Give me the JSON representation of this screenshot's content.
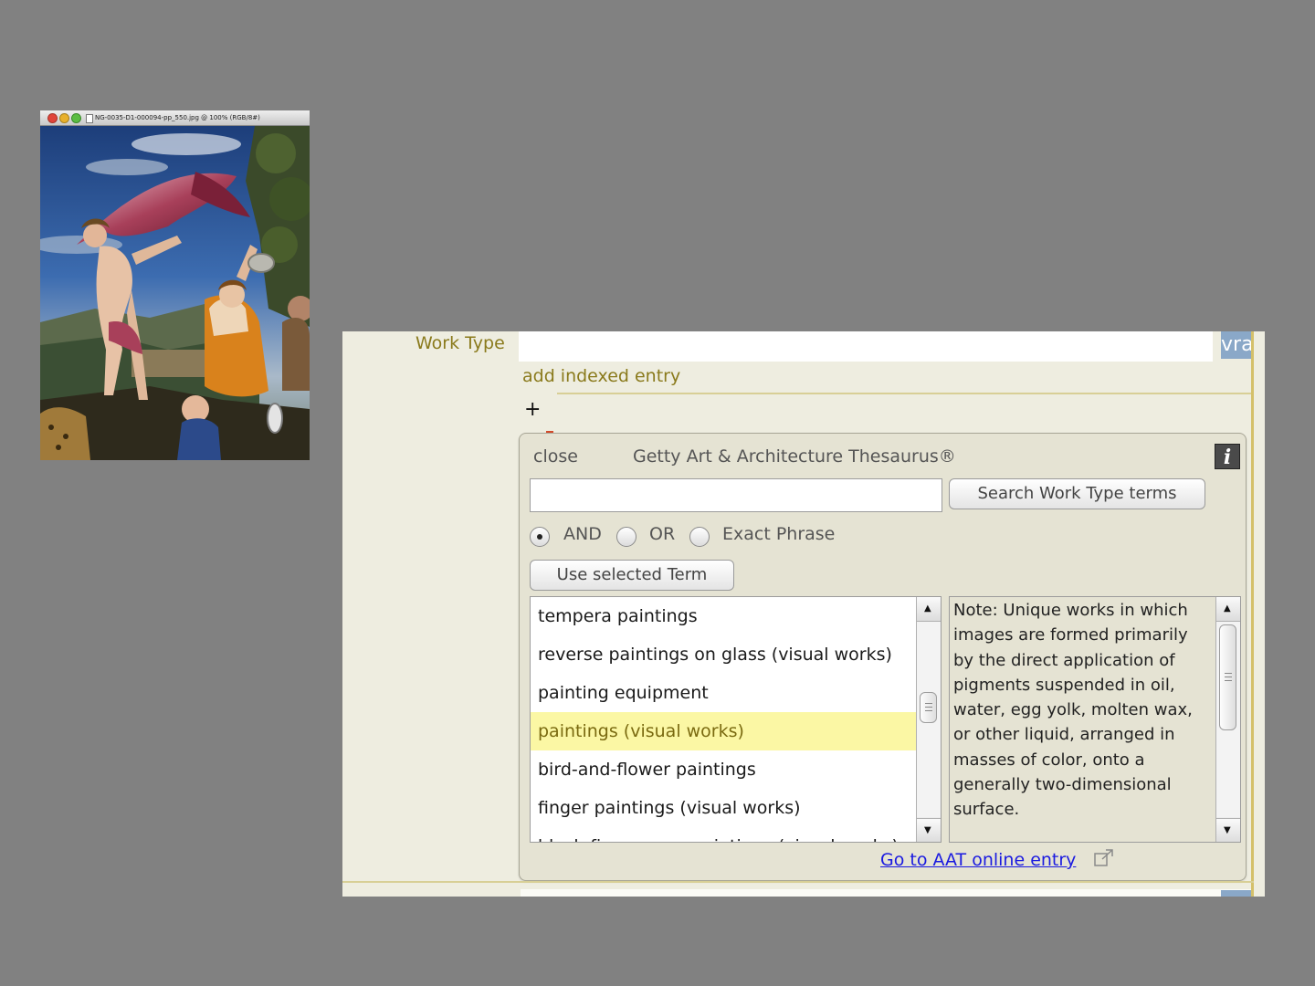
{
  "image_window": {
    "title": "NG-0035-D1-000094-pp_550.jpg @ 100% (RGB/8#)",
    "traffic_light_colors": [
      "#e0443a",
      "#e8b02c",
      "#5bbd43"
    ]
  },
  "record": {
    "work_type_label": "Work Type",
    "work_type_value": "",
    "vra_tab_label": "vra",
    "add_indexed_entry_label": "add indexed entry",
    "add_button_label": "+"
  },
  "thesaurus": {
    "close_label": "close",
    "title": "Getty Art & Architecture Thesaurus®",
    "info_icon_label": "i",
    "search_query": "",
    "search_button_label": "Search Work Type terms",
    "match_modes": [
      {
        "label": "AND",
        "selected": true
      },
      {
        "label": "OR",
        "selected": false
      },
      {
        "label": "Exact Phrase",
        "selected": false
      }
    ],
    "use_term_button_label": "Use selected Term",
    "terms": [
      {
        "label": "tempera paintings",
        "selected": false
      },
      {
        "label": "reverse paintings on glass (visual works)",
        "selected": false
      },
      {
        "label": "painting equipment",
        "selected": false
      },
      {
        "label": "paintings (visual works)",
        "selected": true
      },
      {
        "label": "bird-and-flower paintings",
        "selected": false
      },
      {
        "label": "finger paintings (visual works)",
        "selected": false
      },
      {
        "label": "black-figure vase paintings (visual works)",
        "selected": false
      }
    ],
    "note": "Note: Unique works in which images are formed primarily by the direct application of pigments suspended in oil, water, egg yolk, molten wax, or other liquid, arranged in masses of color, onto a generally two-dimensional surface.",
    "aat_link_label": "Go to AAT online entry"
  },
  "colors": {
    "background": "#818181",
    "label_olive": "#8a7a1c",
    "selected_row": "#fbf7a4",
    "link_blue": "#1a1ae0",
    "vra_tab_blue": "#8aa8c8"
  }
}
